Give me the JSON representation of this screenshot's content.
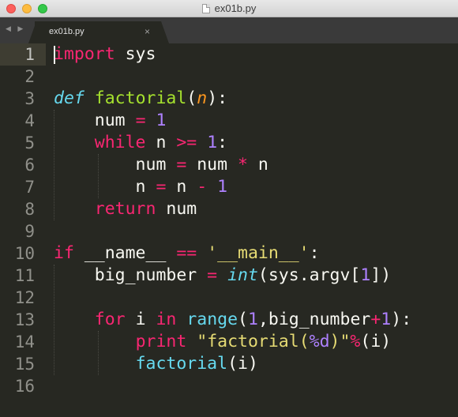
{
  "window": {
    "title": "ex01b.py"
  },
  "tab": {
    "label": "ex01b.py",
    "close": "×"
  },
  "nav": {
    "arrows": "◀ ▶"
  },
  "gutter": [
    "1",
    "2",
    "3",
    "4",
    "5",
    "6",
    "7",
    "8",
    "9",
    "10",
    "11",
    "12",
    "13",
    "14",
    "15",
    "16"
  ],
  "code_lines": [
    [
      [
        "kw",
        "import"
      ],
      [
        "tx",
        " sys"
      ]
    ],
    [],
    [
      [
        "st",
        "def"
      ],
      [
        "tx",
        " "
      ],
      [
        "fn",
        "factorial"
      ],
      [
        "tx",
        "("
      ],
      [
        "pr",
        "n"
      ],
      [
        "tx",
        "):"
      ]
    ],
    [
      [
        "tx",
        "    num "
      ],
      [
        "op",
        "="
      ],
      [
        "tx",
        " "
      ],
      [
        "num",
        "1"
      ]
    ],
    [
      [
        "tx",
        "    "
      ],
      [
        "kw",
        "while"
      ],
      [
        "tx",
        " n "
      ],
      [
        "op",
        ">="
      ],
      [
        "tx",
        " "
      ],
      [
        "num",
        "1"
      ],
      [
        "tx",
        ":"
      ]
    ],
    [
      [
        "tx",
        "        num "
      ],
      [
        "op",
        "="
      ],
      [
        "tx",
        " num "
      ],
      [
        "op",
        "*"
      ],
      [
        "tx",
        " n"
      ]
    ],
    [
      [
        "tx",
        "        n "
      ],
      [
        "op",
        "="
      ],
      [
        "tx",
        " n "
      ],
      [
        "op",
        "-"
      ],
      [
        "tx",
        " "
      ],
      [
        "num",
        "1"
      ]
    ],
    [
      [
        "tx",
        "    "
      ],
      [
        "kw",
        "return"
      ],
      [
        "tx",
        " num"
      ]
    ],
    [],
    [
      [
        "kw",
        "if"
      ],
      [
        "tx",
        " __name__ "
      ],
      [
        "op",
        "=="
      ],
      [
        "tx",
        " "
      ],
      [
        "str",
        "'__main__'"
      ],
      [
        "tx",
        ":"
      ]
    ],
    [
      [
        "tx",
        "    big_number "
      ],
      [
        "op",
        "="
      ],
      [
        "tx",
        " "
      ],
      [
        "st",
        "int"
      ],
      [
        "tx",
        "(sys.argv["
      ],
      [
        "num",
        "1"
      ],
      [
        "tx",
        "])"
      ]
    ],
    [],
    [
      [
        "tx",
        "    "
      ],
      [
        "kw",
        "for"
      ],
      [
        "tx",
        " i "
      ],
      [
        "kw",
        "in"
      ],
      [
        "tx",
        " "
      ],
      [
        "bi",
        "range"
      ],
      [
        "tx",
        "("
      ],
      [
        "num",
        "1"
      ],
      [
        "tx",
        ",big_number"
      ],
      [
        "op",
        "+"
      ],
      [
        "num",
        "1"
      ],
      [
        "tx",
        "):"
      ]
    ],
    [
      [
        "tx",
        "        "
      ],
      [
        "kw",
        "print"
      ],
      [
        "tx",
        " "
      ],
      [
        "str",
        "\"factorial("
      ],
      [
        "num",
        "%d"
      ],
      [
        "str",
        ")\""
      ],
      [
        "op",
        "%"
      ],
      [
        "tx",
        "(i)"
      ]
    ],
    [
      [
        "tx",
        "        "
      ],
      [
        "bi",
        "factorial"
      ],
      [
        "tx",
        "(i)"
      ]
    ],
    []
  ]
}
